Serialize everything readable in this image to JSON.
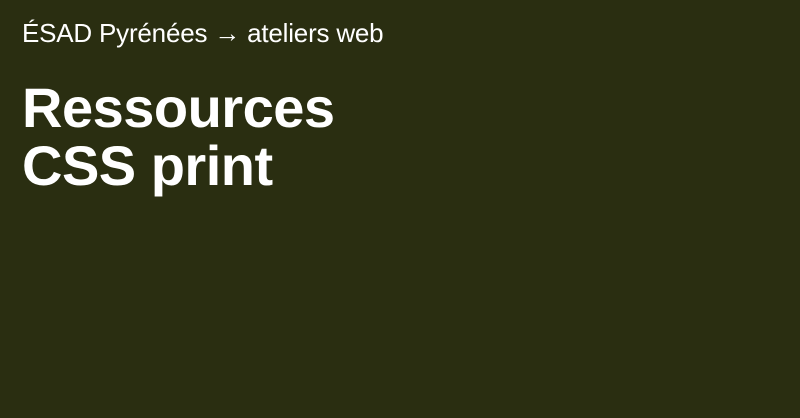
{
  "background_color": "#2a2e11",
  "text_color": "#ffffff",
  "breadcrumb": {
    "text": "ÉSAD Pyrénées → ateliers web"
  },
  "title": {
    "line1": "Ressources",
    "line2": "CSS print"
  }
}
